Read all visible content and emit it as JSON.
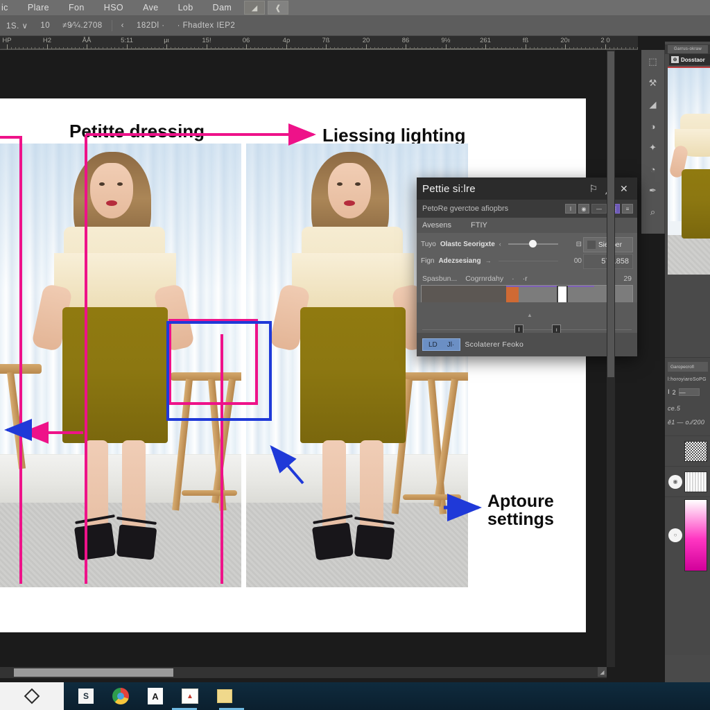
{
  "app": {
    "menubar": {
      "items": [
        "ic",
        "Plare",
        "Fon",
        "HSO",
        "Ave",
        "Lob",
        "Dam"
      ],
      "icon_buttons": [
        "image-icon",
        "brush-icon"
      ]
    },
    "optionsbar": {
      "segments": [
        "1S. ∨",
        "10",
        "≠9⁄¼.2708",
        "‹",
        "182Dl ·",
        "· Fhadtex IEP2"
      ]
    },
    "ruler": {
      "labels": [
        "HP",
        "H2",
        "ÅÅ",
        "5:11",
        "μι",
        "15!",
        "06",
        "4ρ",
        "7ß",
        "20",
        "86",
        "9½",
        "261",
        "fß",
        "20ı",
        "2 0"
      ]
    }
  },
  "toolbar": {
    "tools": [
      {
        "name": "marquee-tool",
        "glyph": "⬚"
      },
      {
        "name": "stamp-tool",
        "glyph": "⚒"
      },
      {
        "name": "eraser-tool",
        "glyph": "◢"
      },
      {
        "name": "gradient-tool",
        "glyph": "◑"
      },
      {
        "name": "dodge-tool",
        "glyph": "✦"
      },
      {
        "name": "blur-tool",
        "glyph": "◔"
      },
      {
        "name": "pen-tool",
        "glyph": "✒"
      },
      {
        "name": "zoom-tool",
        "glyph": "⌕"
      }
    ]
  },
  "canvas": {
    "annotations": [
      {
        "name": "annotation-petitte-dressing",
        "text": "Petitte dressing",
        "color": "#0c0c0c"
      },
      {
        "name": "annotation-liessing-lighting",
        "text": "Liessing lighting",
        "color": "#0c0c0c"
      },
      {
        "name": "annotation-aptoure-settings",
        "text": "Aptoure\nsettings",
        "color": "#0c0c0c"
      }
    ],
    "overlay_colors": {
      "magenta": "#ee1289",
      "blue": "#1f39d8"
    }
  },
  "dialog": {
    "title": "Pettie si:lre",
    "title_buttons": [
      "flag-icon",
      "pencil-icon",
      "close-icon"
    ],
    "subtitle": "PetoRe gverctoe afiopbrs",
    "segments": [
      "I",
      "◉",
      "—",
      "▒",
      "≡"
    ],
    "header": {
      "left": "Avesens",
      "right": "FTIY"
    },
    "fields": [
      {
        "name": "field-row-1",
        "prefix": "Tuyo",
        "label": "Olastc Seorigxte",
        "caret": "‹",
        "value": "",
        "icon": "⊟",
        "side_button": "Siesoer"
      },
      {
        "name": "field-row-2",
        "prefix": "Fign",
        "label": "Adezsesiang",
        "caret": "→",
        "value": "00",
        "side_value": "578.858"
      }
    ],
    "histogram": {
      "label_left": "Spasbun...",
      "label_mid": "Cogrnrdahy",
      "tick1": "·",
      "tick2": "·r",
      "value_right": "29"
    },
    "slider_stops": [
      "I",
      "ı"
    ],
    "footer": {
      "button_left": "LD",
      "button_right": "Jl·",
      "text": "Scolaterer  Feoko"
    }
  },
  "right_panel": {
    "tab_label": "Garrus-okraw",
    "layer_header": {
      "badge": "⊚",
      "label": "Dosstaor"
    },
    "lower": {
      "tab": "Garopecrofl",
      "subtitle": "l:horoyiaroSoPG",
      "ctrl_row": {
        "icon1": "Ⅰ",
        "icon2": "2",
        "field": "—"
      },
      "row1": "ce.5",
      "row2": "ĕ1   — o.⁄⁄200"
    },
    "layers": [
      {
        "name": "layer-noise",
        "thumb": "noise",
        "has_eye": false
      },
      {
        "name": "layer-pattern",
        "thumb": "pattern",
        "has_eye": true
      },
      {
        "name": "layer-gradient",
        "thumb": "grad",
        "has_eye": true
      }
    ]
  },
  "taskbar": {
    "start_icon": "diamond-icon",
    "items": [
      {
        "name": "taskbar-explorer",
        "icon": "folder-icon",
        "label": "S"
      },
      {
        "name": "taskbar-chrome",
        "icon": "chrome-icon",
        "label": ""
      },
      {
        "name": "taskbar-acrobat",
        "icon": "acrobat-icon",
        "label": "A"
      },
      {
        "name": "taskbar-photo",
        "icon": "photos-icon",
        "label": "▲"
      },
      {
        "name": "taskbar-notes",
        "icon": "notes-icon",
        "label": ""
      }
    ]
  }
}
